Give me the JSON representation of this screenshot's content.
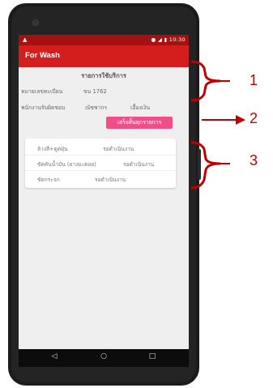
{
  "status_bar": {
    "left_icon": "warning-icon",
    "time": "10:30"
  },
  "app_bar": {
    "title": "For Wash"
  },
  "service_info": {
    "section_title": "รายการใช้บริการ",
    "plate_label": "หมายเลขทะเบียน",
    "plate_value": "ขน 1762",
    "staff_label": "พนักงานรับผิดชอบ",
    "staff_first_name": "ณัชชากร",
    "staff_last_name": "เอื้องเงิน"
  },
  "finish_button": {
    "label": "เสร็จสิ้นทุกรายการ",
    "color": "#f04e88"
  },
  "services": [
    {
      "name": "ล้างสี+ดูดฝุ่น",
      "status": "รอดำเนินงาน"
    },
    {
      "name": "ขัดคันน้ำมัน (ยางมะตอย)",
      "status": "รอดำเนินงาน"
    },
    {
      "name": "ขัดกระจก",
      "status": "รอดำเนินงาน"
    }
  ],
  "nav_bar": {
    "back_icon": "back-triangle-icon",
    "home_icon": "home-circle-icon",
    "recents_icon": "recents-square-icon"
  },
  "annotations": [
    "1",
    "2",
    "3"
  ],
  "colors": {
    "status_bar": "#a51111",
    "app_bar": "#d41d1d",
    "annotation": "#c00000"
  }
}
